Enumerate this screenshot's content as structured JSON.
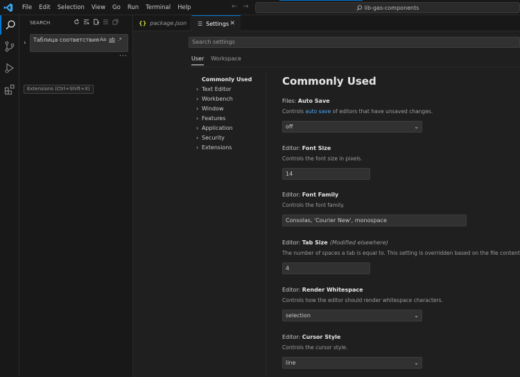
{
  "titlebar": {
    "menu": [
      "File",
      "Edit",
      "Selection",
      "View",
      "Go",
      "Run",
      "Terminal",
      "Help"
    ],
    "command_center": "lib-gas-components"
  },
  "sidebar": {
    "title": "SEARCH",
    "search_query": "Таблица соответствия",
    "options": {
      "match_case": "Aa",
      "whole_word": "ab",
      "regex": ".*"
    },
    "more": "···"
  },
  "tooltip": "Extensions (Ctrl+Shift+X)",
  "tabs": [
    {
      "label": "package.json",
      "icon": "{}"
    },
    {
      "label": "Settings",
      "close": "✕"
    }
  ],
  "settings": {
    "search_placeholder": "Search settings",
    "scope_tabs": [
      "User",
      "Workspace"
    ],
    "toc": [
      "Commonly Used",
      "Text Editor",
      "Workbench",
      "Window",
      "Features",
      "Application",
      "Security",
      "Extensions"
    ],
    "heading": "Commonly Used",
    "items": [
      {
        "category": "Files: ",
        "name": "Auto Save",
        "desc_before": "Controls ",
        "desc_link": "auto save",
        "desc_after": " of editors that have unsaved changes.",
        "value": "off",
        "type": "dropdown"
      },
      {
        "category": "Editor: ",
        "name": "Font Size",
        "desc": "Controls the font size in pixels.",
        "value": "14",
        "type": "text"
      },
      {
        "category": "Editor: ",
        "name": "Font Family",
        "desc": "Controls the font family.",
        "value": "Consolas, 'Courier New', monospace",
        "type": "text"
      },
      {
        "category": "Editor: ",
        "name": "Tab Size",
        "modified": "(Modified elsewhere)",
        "desc": "The number of spaces a tab is equal to. This setting is overridden based on the file contents wh",
        "value": "4",
        "type": "text"
      },
      {
        "category": "Editor: ",
        "name": "Render Whitespace",
        "desc": "Controls how the editor should render whitespace characters.",
        "value": "selection",
        "type": "dropdown"
      },
      {
        "category": "Editor: ",
        "name": "Cursor Style",
        "desc": "Controls the cursor style.",
        "value": "line",
        "type": "dropdown"
      }
    ]
  },
  "colors": {
    "accent": "#0078d4",
    "link": "#4daafc",
    "background": "#1f1f1f",
    "sidebar": "#181818"
  }
}
